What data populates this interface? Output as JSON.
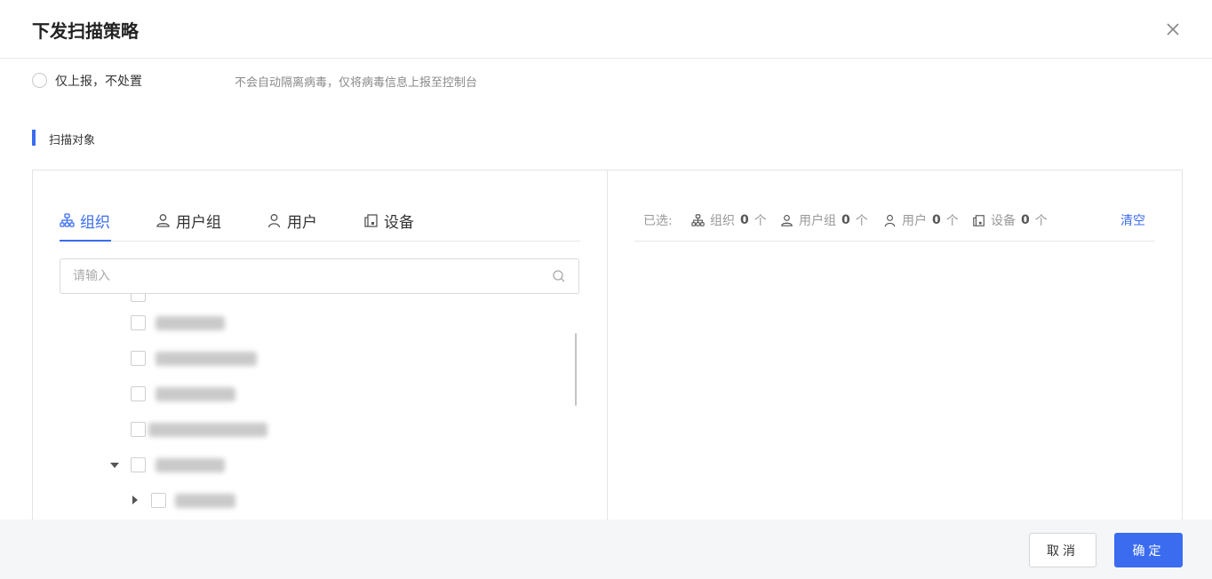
{
  "dialog": {
    "title": "下发扫描策略"
  },
  "disposal_option": {
    "label": "仅上报，不处置",
    "description": "不会自动隔离病毒，仅将病毒信息上报至控制台"
  },
  "scan_target": {
    "section_title": "扫描对象",
    "tabs": [
      {
        "label": "组织",
        "icon": "org-tree-icon",
        "active": true
      },
      {
        "label": "用户组",
        "icon": "user-group-icon",
        "active": false
      },
      {
        "label": "用户",
        "icon": "user-icon",
        "active": false
      },
      {
        "label": "设备",
        "icon": "device-icon",
        "active": false
      }
    ],
    "search_placeholder": "请输入",
    "selected": {
      "prefix": "已选:",
      "org_label": "组织",
      "org_count": "0",
      "user_group_label": "用户组",
      "user_group_count": "0",
      "user_label": "用户",
      "user_count": "0",
      "device_label": "设备",
      "device_count": "0",
      "unit": "个",
      "clear_label": "清空"
    }
  },
  "footer": {
    "cancel_label": "取消",
    "confirm_label": "确定"
  },
  "colors": {
    "accent": "#3b6cf0"
  }
}
